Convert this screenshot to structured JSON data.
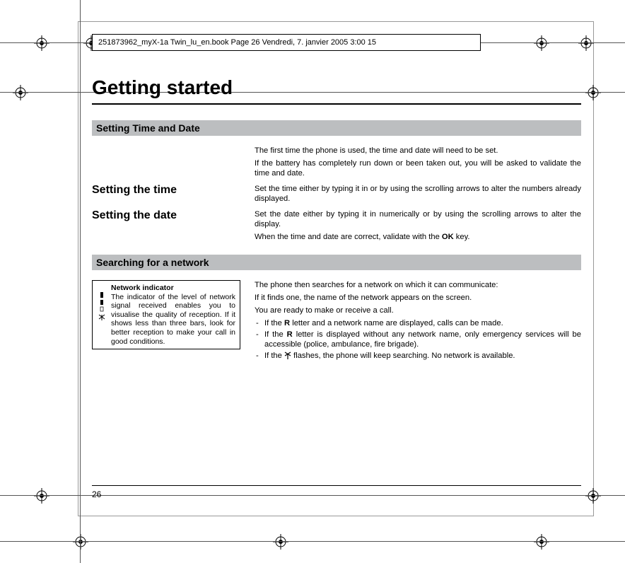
{
  "header": {
    "text": "251873962_myX-1a Twin_lu_en.book  Page 26  Vendredi, 7. janvier 2005  3:00 15"
  },
  "page": {
    "title": "Getting started",
    "number": "26"
  },
  "section1": {
    "title": "Setting Time and Date",
    "intro1": "The first time the phone is used, the time and date will need to be set.",
    "intro2": "If the battery has completely run down or been taken out, you will be asked to validate the time and date.",
    "sub1_title": "Setting the time",
    "sub1_body": "Set the time either by typing it in or by using the scrolling arrows to alter the numbers already displayed.",
    "sub2_title": "Setting the date",
    "sub2_body1": "Set the date either by typing it in numerically or by using the scrolling arrows to alter the display.",
    "sub2_body2_pre": "When the time and date are correct, validate with the ",
    "sub2_body2_bold": "OK",
    "sub2_body2_post": " key."
  },
  "section2": {
    "title": "Searching for a network",
    "sidebar_title": "Network indicator",
    "sidebar_body": "The indicator of the level of network signal received enables you to visualise the quality of reception. If it shows less than three bars, look for better reception to make your call in good conditions.",
    "body1": "The phone then searches for a network on which it can communicate:",
    "body2": "If it finds one, the name of the network appears on the screen.",
    "body3": "You are ready to make or receive a call.",
    "li1_pre": "If the ",
    "li1_b": "R",
    "li1_post": " letter and a network name are displayed, calls can be made.",
    "li2_pre": "If the ",
    "li2_b": "R",
    "li2_post": " letter is displayed without any network name, only emergency services will be accessible (police, ambulance, fire brigade).",
    "li3_pre": "If the ",
    "li3_post": " flashes, the phone will keep searching. No network is available."
  }
}
